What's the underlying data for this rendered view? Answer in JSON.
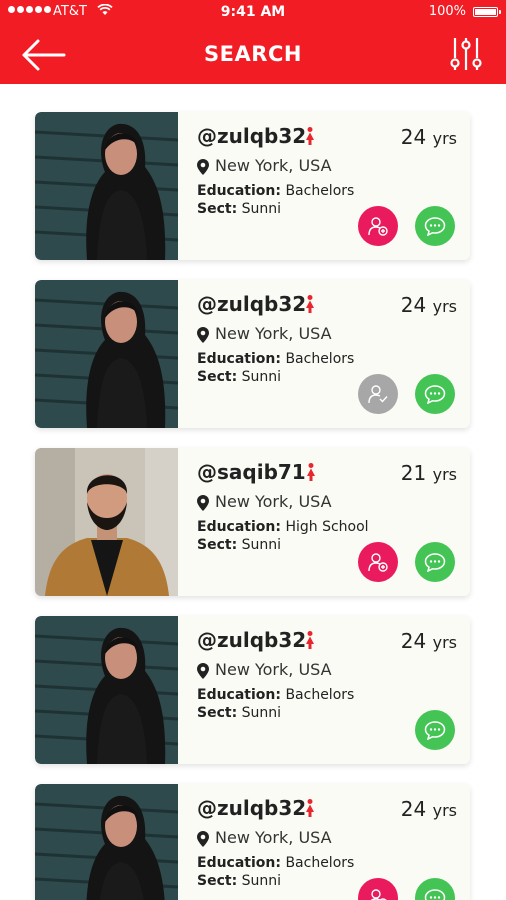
{
  "status": {
    "carrier": "AT&T",
    "time": "9:41 AM",
    "battery": "100%",
    "battery_level": 1.0
  },
  "header": {
    "title": "SEARCH",
    "back_icon": "back-arrow-icon",
    "filter_icon": "sliders-icon"
  },
  "colors": {
    "brand_red": "#f21c24",
    "add_pink": "#ea1a5e",
    "chat_green": "#43c455",
    "pending_gray": "#a7a7a7"
  },
  "profiles": [
    {
      "username": "@zulqb32",
      "age": "24",
      "age_unit": "yrs",
      "location": "New York, USA",
      "education_label": "Education:",
      "education": "Bachelors",
      "sect_label": "Sect:",
      "sect": "Sunni",
      "request": "add"
    },
    {
      "username": "@zulqb32",
      "age": "24",
      "age_unit": "yrs",
      "location": "New York, USA",
      "education_label": "Education:",
      "education": "Bachelors",
      "sect_label": "Sect:",
      "sect": "Sunni",
      "request": "sent"
    },
    {
      "username": "@saqib71",
      "age": "21",
      "age_unit": "yrs",
      "location": "New York, USA",
      "education_label": "Education:",
      "education": "High School",
      "sect_label": "Sect:",
      "sect": "Sunni",
      "request": "add"
    },
    {
      "username": "@zulqb32",
      "age": "24",
      "age_unit": "yrs",
      "location": "New York, USA",
      "education_label": "Education:",
      "education": "Bachelors",
      "sect_label": "Sect:",
      "sect": "Sunni",
      "request": "none"
    },
    {
      "username": "@zulqb32",
      "age": "24",
      "age_unit": "yrs",
      "location": "New York, USA",
      "education_label": "Education:",
      "education": "Bachelors",
      "sect_label": "Sect:",
      "sect": "Sunni",
      "request": "add"
    }
  ]
}
